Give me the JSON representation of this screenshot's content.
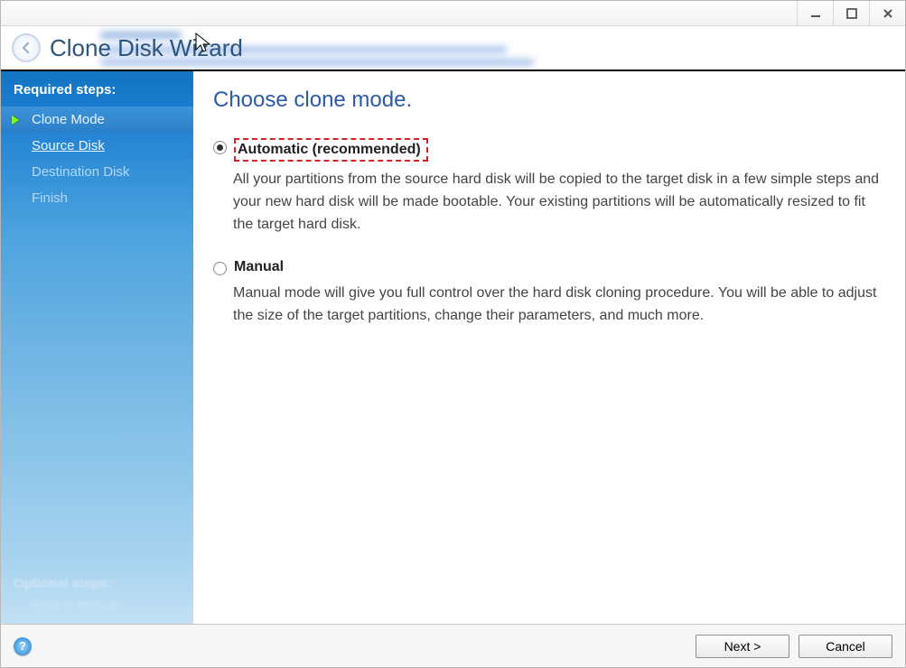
{
  "window": {
    "title": "Clone Disk Wizard"
  },
  "sidebar": {
    "section_label": "Required steps:",
    "steps": [
      {
        "label": "Clone Mode"
      },
      {
        "label": "Source Disk"
      },
      {
        "label": "Destination Disk"
      },
      {
        "label": "Finish"
      }
    ],
    "optional_label": "Optional steps:",
    "optional_sub": "What to exclude"
  },
  "content": {
    "heading": "Choose clone mode.",
    "option_auto": {
      "label": "Automatic (recommended)",
      "desc": "All your partitions from the source hard disk will be copied to the target disk in a few simple steps and your new hard disk will be made bootable. Your existing partitions will be automatically resized to fit the target hard disk.",
      "selected": true
    },
    "option_manual": {
      "label": "Manual",
      "desc": "Manual mode will give you full control over the hard disk cloning procedure. You will be able to adjust the size of the target partitions, change their parameters, and much more.",
      "selected": false
    }
  },
  "footer": {
    "next_label": "Next >",
    "cancel_label": "Cancel",
    "help_glyph": "?"
  }
}
